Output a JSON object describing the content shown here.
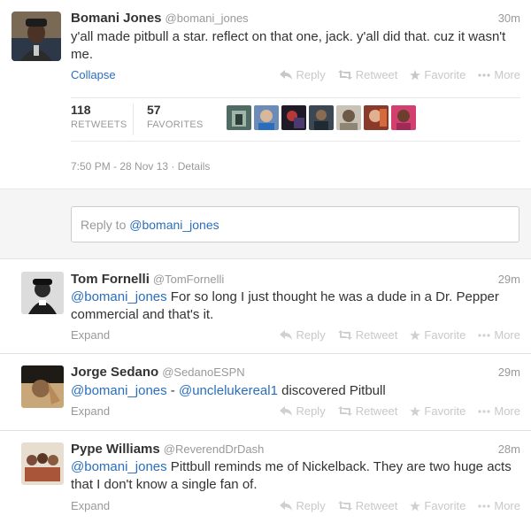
{
  "main_tweet": {
    "fullname": "Bomani Jones",
    "screenname": "@bomani_jones",
    "time": "30m",
    "text": "y'all made pitbull a star. reflect on that one, jack. y'all did that. cuz it wasn't me.",
    "toggle": "Collapse",
    "retweets_count": "118",
    "retweets_label": "RETWEETS",
    "favorites_count": "57",
    "favorites_label": "FAVORITES",
    "timestamp": "7:50 PM - 28 Nov 13",
    "separator": "·",
    "details_link": "Details"
  },
  "actions": {
    "reply": "Reply",
    "retweet": "Retweet",
    "favorite": "Favorite",
    "more": "More"
  },
  "reply_box": {
    "prefix": "Reply to ",
    "mention": "@bomani_jones"
  },
  "replies": [
    {
      "fullname": "Tom Fornelli",
      "screenname": "@TomFornelli",
      "time": "29m",
      "mention": "@bomani_jones",
      "text": " For so long I just thought he was a dude in a Dr. Pepper commercial and that's it.",
      "toggle": "Expand"
    },
    {
      "fullname": "Jorge Sedano",
      "screenname": "@SedanoESPN",
      "time": "29m",
      "mention": "@bomani_jones",
      "text_mid": " - ",
      "mention2": "@unclelukereal1",
      "text": " discovered Pitbull",
      "toggle": "Expand"
    },
    {
      "fullname": "Pype Williams",
      "screenname": "@ReverendDrDash",
      "time": "28m",
      "mention": "@bomani_jones",
      "text": " Pittbull reminds me of Nickelback. They are two huge acts that I don't know a single fan of.",
      "toggle": "Expand"
    }
  ]
}
